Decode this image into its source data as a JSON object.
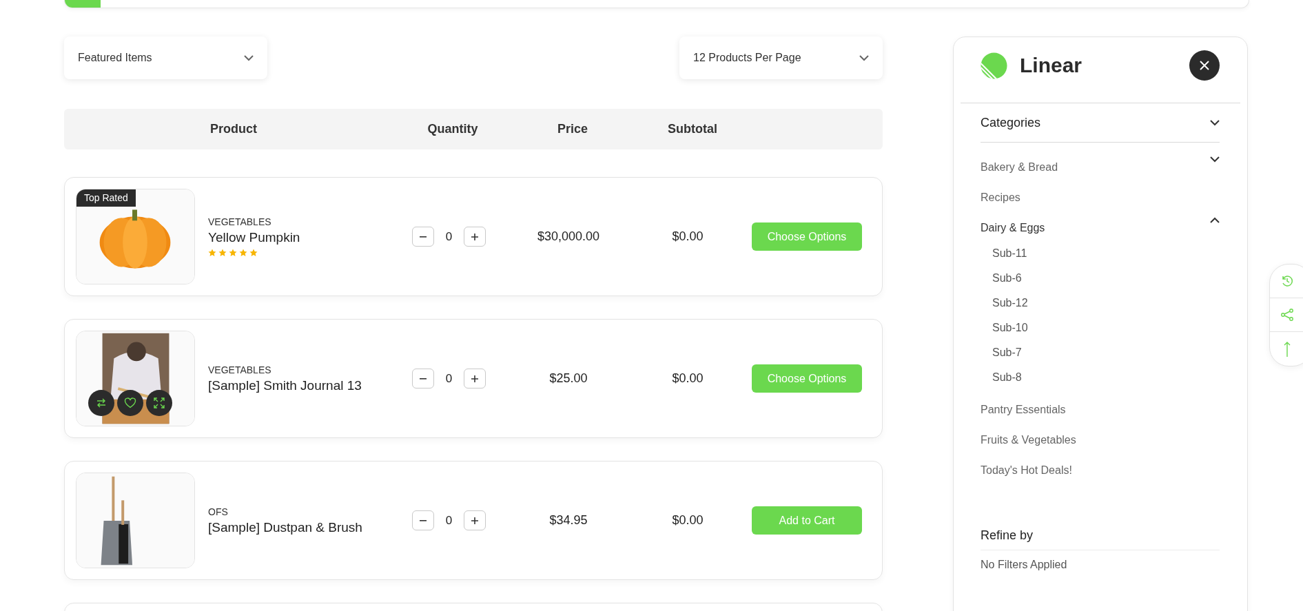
{
  "top_progress": {
    "level": 0.03
  },
  "sort": {
    "value": "Featured Items"
  },
  "per_page": {
    "value": "12 Products Per Page"
  },
  "table": {
    "columns": [
      "Product",
      "Quantity",
      "Price",
      "Subtotal"
    ],
    "rows": [
      {
        "badge": "Top Rated",
        "category": "VEGETABLES",
        "name": "Yellow Pumpkin",
        "stars": 5,
        "quantity": "0",
        "price": "$30,000.00",
        "subtotal": "$0.00",
        "button": "Choose Options",
        "hovered": false
      },
      {
        "category": "VEGETABLES",
        "name": "[Sample] Smith Journal 13",
        "quantity": "0",
        "price": "$25.00",
        "subtotal": "$0.00",
        "button": "Choose Options",
        "hovered": true
      },
      {
        "category": "OFS",
        "name": "[Sample] Dustpan & Brush",
        "quantity": "0",
        "price": "$34.95",
        "subtotal": "$0.00",
        "button": "Add to Cart",
        "hovered": false
      }
    ]
  },
  "sidebar": {
    "brand": "Linear",
    "categories": {
      "title": "Categories",
      "items": [
        {
          "label": "Bakery & Bread",
          "expandable": true,
          "expanded": false
        },
        {
          "label": "Recipes",
          "expandable": false,
          "expanded": false
        },
        {
          "label": "Dairy & Eggs",
          "expandable": true,
          "expanded": true,
          "children": [
            {
              "label": "Sub-11"
            },
            {
              "label": "Sub-6"
            },
            {
              "label": "Sub-12"
            },
            {
              "label": "Sub-10"
            },
            {
              "label": "Sub-7"
            },
            {
              "label": "Sub-8"
            }
          ]
        },
        {
          "label": "Pantry Essentials",
          "expandable": false,
          "expanded": false
        },
        {
          "label": "Fruits & Vegetables",
          "expandable": false,
          "expanded": false
        },
        {
          "label": "Today's Hot Deals!",
          "expandable": false,
          "expanded": false
        }
      ]
    },
    "refine": {
      "title": "Refine by",
      "empty_text": "No Filters Applied"
    }
  }
}
